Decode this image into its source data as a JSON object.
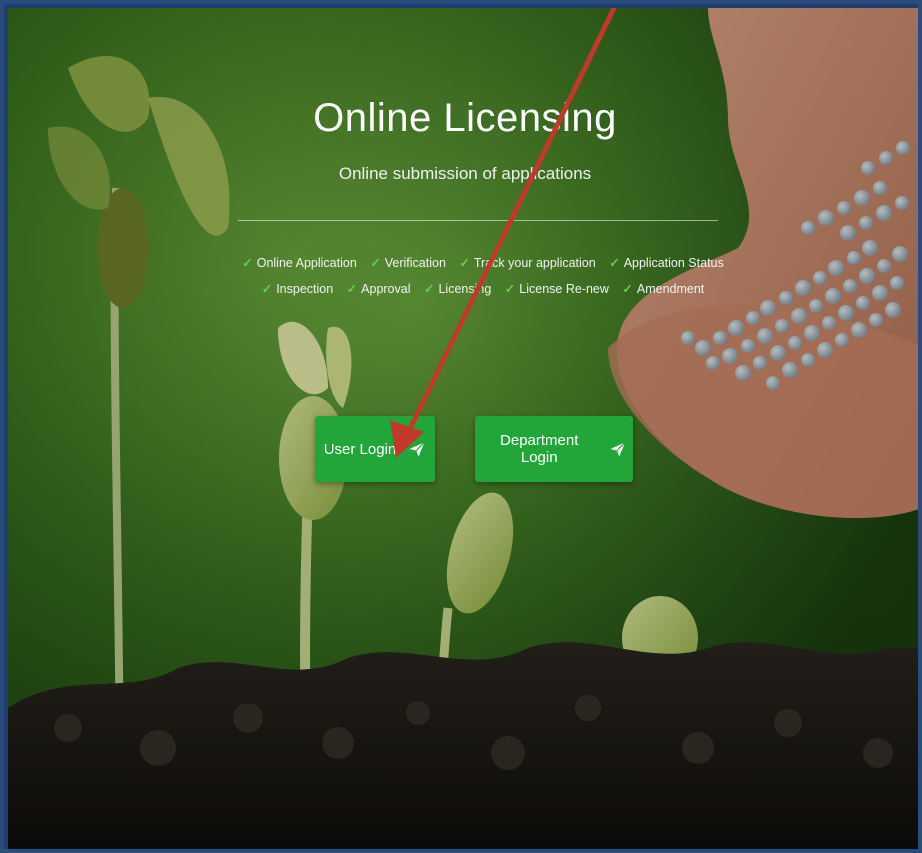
{
  "hero": {
    "title": "Online Licensing",
    "subtitle": "Online submission of applications",
    "features": [
      "Online Application",
      "Verification",
      "Track your application",
      "Application Status",
      "Inspection",
      "Approval",
      "Licensing",
      "License Re-new",
      "Amendment"
    ],
    "check_glyph": "✓"
  },
  "buttons": {
    "user_login": "User Login",
    "department_login": "Department Login",
    "icon": "paper-plane-icon"
  },
  "colors": {
    "button_green": "#22a63a",
    "check_green": "#5fd14a",
    "arrow_red": "#c0392b",
    "frame_blue": "#2a4d7d"
  }
}
